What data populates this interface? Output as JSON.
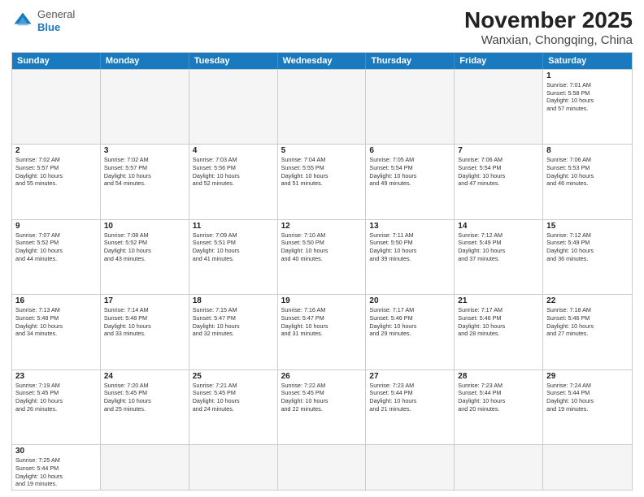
{
  "logo": {
    "general": "General",
    "blue": "Blue"
  },
  "title": "November 2025",
  "subtitle": "Wanxian, Chongqing, China",
  "day_headers": [
    "Sunday",
    "Monday",
    "Tuesday",
    "Wednesday",
    "Thursday",
    "Friday",
    "Saturday"
  ],
  "weeks": [
    [
      {
        "day": "",
        "info": ""
      },
      {
        "day": "",
        "info": ""
      },
      {
        "day": "",
        "info": ""
      },
      {
        "day": "",
        "info": ""
      },
      {
        "day": "",
        "info": ""
      },
      {
        "day": "",
        "info": ""
      },
      {
        "day": "1",
        "info": "Sunrise: 7:01 AM\nSunset: 5:58 PM\nDaylight: 10 hours\nand 57 minutes."
      }
    ],
    [
      {
        "day": "2",
        "info": "Sunrise: 7:02 AM\nSunset: 5:57 PM\nDaylight: 10 hours\nand 55 minutes."
      },
      {
        "day": "3",
        "info": "Sunrise: 7:02 AM\nSunset: 5:57 PM\nDaylight: 10 hours\nand 54 minutes."
      },
      {
        "day": "4",
        "info": "Sunrise: 7:03 AM\nSunset: 5:56 PM\nDaylight: 10 hours\nand 52 minutes."
      },
      {
        "day": "5",
        "info": "Sunrise: 7:04 AM\nSunset: 5:55 PM\nDaylight: 10 hours\nand 51 minutes."
      },
      {
        "day": "6",
        "info": "Sunrise: 7:05 AM\nSunset: 5:54 PM\nDaylight: 10 hours\nand 49 minutes."
      },
      {
        "day": "7",
        "info": "Sunrise: 7:06 AM\nSunset: 5:54 PM\nDaylight: 10 hours\nand 47 minutes."
      },
      {
        "day": "8",
        "info": "Sunrise: 7:06 AM\nSunset: 5:53 PM\nDaylight: 10 hours\nand 46 minutes."
      }
    ],
    [
      {
        "day": "9",
        "info": "Sunrise: 7:07 AM\nSunset: 5:52 PM\nDaylight: 10 hours\nand 44 minutes."
      },
      {
        "day": "10",
        "info": "Sunrise: 7:08 AM\nSunset: 5:52 PM\nDaylight: 10 hours\nand 43 minutes."
      },
      {
        "day": "11",
        "info": "Sunrise: 7:09 AM\nSunset: 5:51 PM\nDaylight: 10 hours\nand 41 minutes."
      },
      {
        "day": "12",
        "info": "Sunrise: 7:10 AM\nSunset: 5:50 PM\nDaylight: 10 hours\nand 40 minutes."
      },
      {
        "day": "13",
        "info": "Sunrise: 7:11 AM\nSunset: 5:50 PM\nDaylight: 10 hours\nand 39 minutes."
      },
      {
        "day": "14",
        "info": "Sunrise: 7:12 AM\nSunset: 5:49 PM\nDaylight: 10 hours\nand 37 minutes."
      },
      {
        "day": "15",
        "info": "Sunrise: 7:12 AM\nSunset: 5:49 PM\nDaylight: 10 hours\nand 36 minutes."
      }
    ],
    [
      {
        "day": "16",
        "info": "Sunrise: 7:13 AM\nSunset: 5:48 PM\nDaylight: 10 hours\nand 34 minutes."
      },
      {
        "day": "17",
        "info": "Sunrise: 7:14 AM\nSunset: 5:48 PM\nDaylight: 10 hours\nand 33 minutes."
      },
      {
        "day": "18",
        "info": "Sunrise: 7:15 AM\nSunset: 5:47 PM\nDaylight: 10 hours\nand 32 minutes."
      },
      {
        "day": "19",
        "info": "Sunrise: 7:16 AM\nSunset: 5:47 PM\nDaylight: 10 hours\nand 31 minutes."
      },
      {
        "day": "20",
        "info": "Sunrise: 7:17 AM\nSunset: 5:46 PM\nDaylight: 10 hours\nand 29 minutes."
      },
      {
        "day": "21",
        "info": "Sunrise: 7:17 AM\nSunset: 5:46 PM\nDaylight: 10 hours\nand 28 minutes."
      },
      {
        "day": "22",
        "info": "Sunrise: 7:18 AM\nSunset: 5:46 PM\nDaylight: 10 hours\nand 27 minutes."
      }
    ],
    [
      {
        "day": "23",
        "info": "Sunrise: 7:19 AM\nSunset: 5:45 PM\nDaylight: 10 hours\nand 26 minutes."
      },
      {
        "day": "24",
        "info": "Sunrise: 7:20 AM\nSunset: 5:45 PM\nDaylight: 10 hours\nand 25 minutes."
      },
      {
        "day": "25",
        "info": "Sunrise: 7:21 AM\nSunset: 5:45 PM\nDaylight: 10 hours\nand 24 minutes."
      },
      {
        "day": "26",
        "info": "Sunrise: 7:22 AM\nSunset: 5:45 PM\nDaylight: 10 hours\nand 22 minutes."
      },
      {
        "day": "27",
        "info": "Sunrise: 7:23 AM\nSunset: 5:44 PM\nDaylight: 10 hours\nand 21 minutes."
      },
      {
        "day": "28",
        "info": "Sunrise: 7:23 AM\nSunset: 5:44 PM\nDaylight: 10 hours\nand 20 minutes."
      },
      {
        "day": "29",
        "info": "Sunrise: 7:24 AM\nSunset: 5:44 PM\nDaylight: 10 hours\nand 19 minutes."
      }
    ],
    [
      {
        "day": "30",
        "info": "Sunrise: 7:25 AM\nSunset: 5:44 PM\nDaylight: 10 hours\nand 19 minutes."
      },
      {
        "day": "",
        "info": ""
      },
      {
        "day": "",
        "info": ""
      },
      {
        "day": "",
        "info": ""
      },
      {
        "day": "",
        "info": ""
      },
      {
        "day": "",
        "info": ""
      },
      {
        "day": "",
        "info": ""
      }
    ]
  ]
}
